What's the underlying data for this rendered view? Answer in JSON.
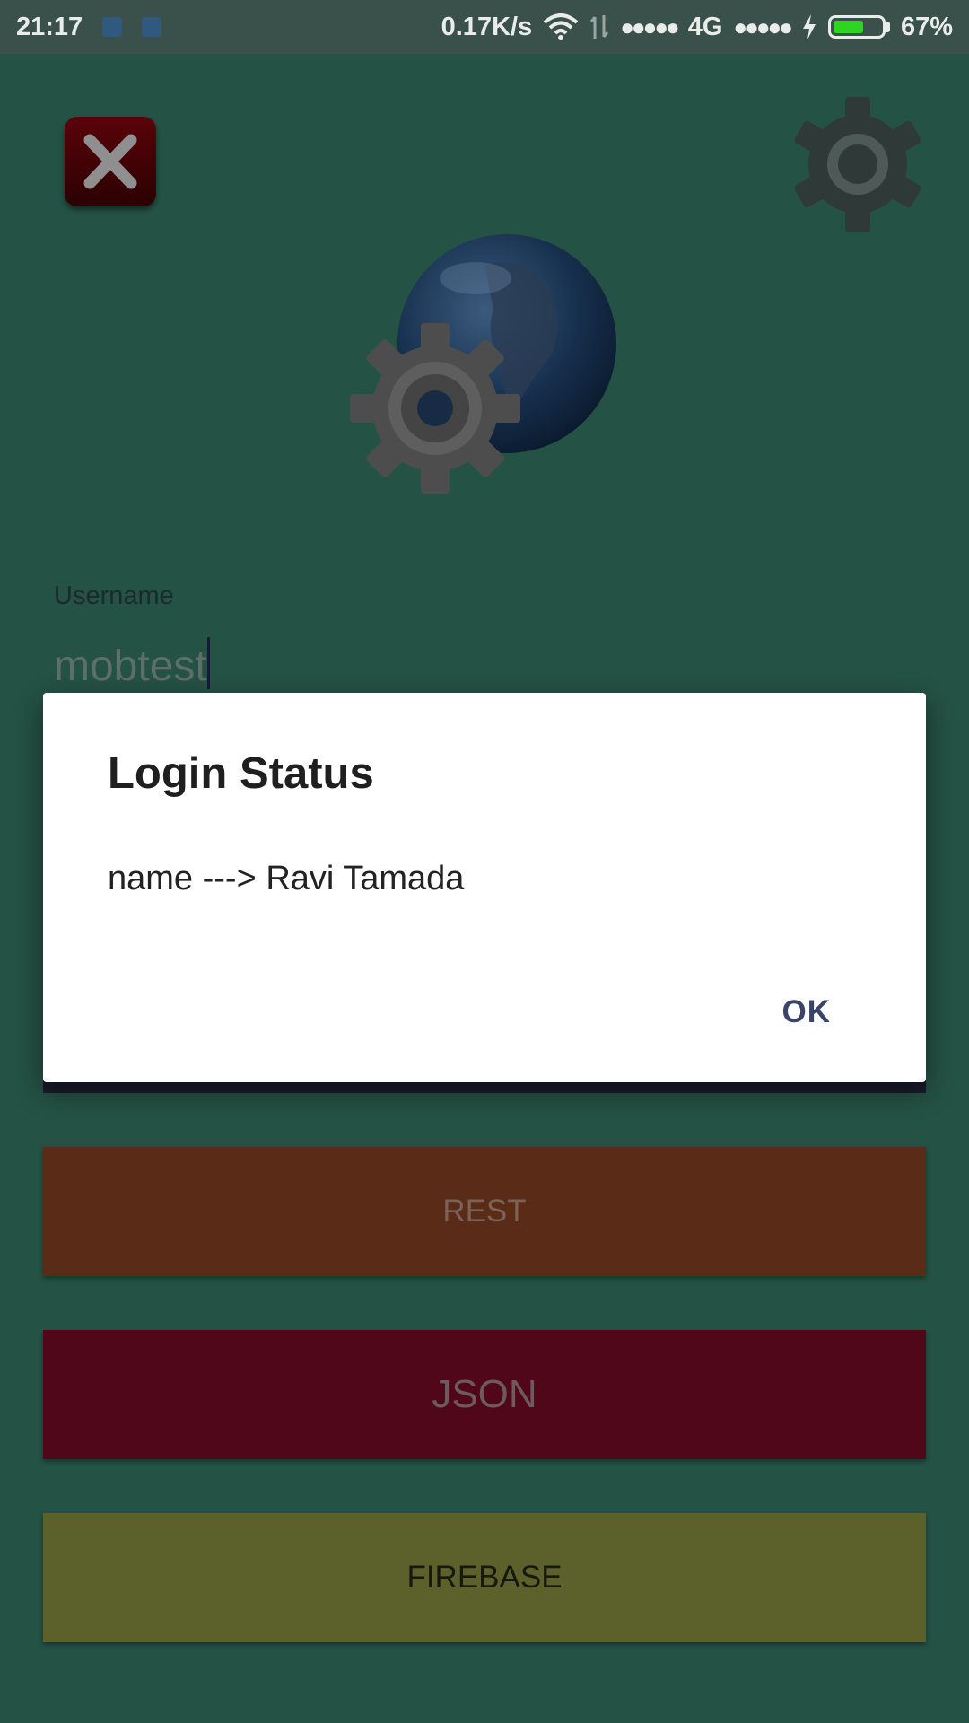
{
  "status_bar": {
    "time": "21:17",
    "net_speed": "0.17K/s",
    "signal_dots": "●●●●●",
    "network_type": "4G",
    "signal_dots_2": "●●●●●",
    "battery_percent": "67%",
    "battery_level": 0.67,
    "battery_color": "#2fd322"
  },
  "icons": {
    "close": "close-icon",
    "settings": "gear-icon",
    "logo": "globe-gear-icon"
  },
  "form": {
    "username_label": "Username",
    "username_value": "mobtest"
  },
  "buttons": {
    "rest": "REST",
    "json": "JSON",
    "firebase": "FIREBASE"
  },
  "colors": {
    "background": "#245244",
    "rest": "#5a2b17",
    "json": "#4f0719",
    "firebase": "#5c612b"
  },
  "dialog": {
    "title": "Login Status",
    "message": "name ---> Ravi Tamada",
    "ok_label": "OK"
  }
}
